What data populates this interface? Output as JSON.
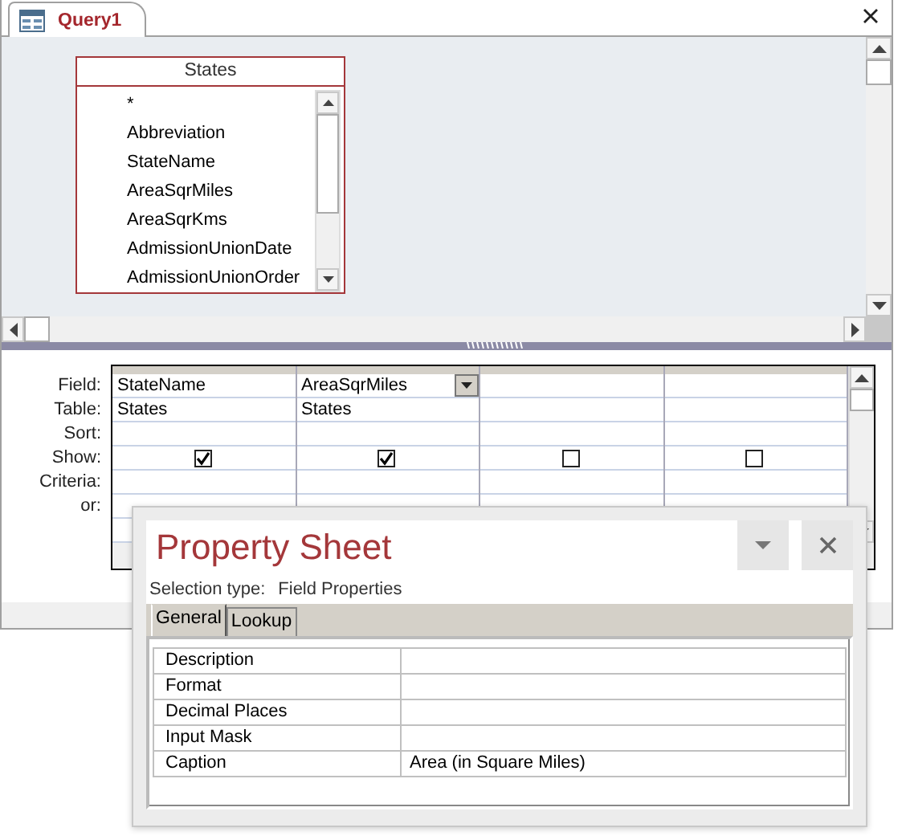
{
  "query_tab": {
    "title": "Query1",
    "selected": true
  },
  "field_list": {
    "title": "States",
    "fields": [
      "*",
      "Abbreviation",
      "StateName",
      "AreaSqrMiles",
      "AreaSqrKms",
      "AdmissionUnionDate",
      "AdmissionUnionOrder"
    ]
  },
  "grid": {
    "row_labels": [
      "Field:",
      "Table:",
      "Sort:",
      "Show:",
      "Criteria:",
      "or:"
    ],
    "columns": [
      {
        "field": "StateName",
        "table": "States",
        "show": true,
        "dropdown": false
      },
      {
        "field": "AreaSqrMiles",
        "table": "States",
        "show": true,
        "dropdown": true
      },
      {
        "show": false,
        "dropdown": false
      },
      {
        "show": false,
        "dropdown": false
      }
    ]
  },
  "property_sheet": {
    "title": "Property Sheet",
    "selection_label": "Selection type:",
    "selection_value": "Field Properties",
    "tabs": [
      {
        "label": "General",
        "selected": true
      },
      {
        "label": "Lookup",
        "selected": false
      }
    ],
    "properties": [
      {
        "name": "Description"
      },
      {
        "name": "Format"
      },
      {
        "name": "Decimal Places"
      },
      {
        "name": "Input Mask"
      },
      {
        "name": "Caption",
        "value": "Area (in Square Miles)"
      }
    ]
  }
}
